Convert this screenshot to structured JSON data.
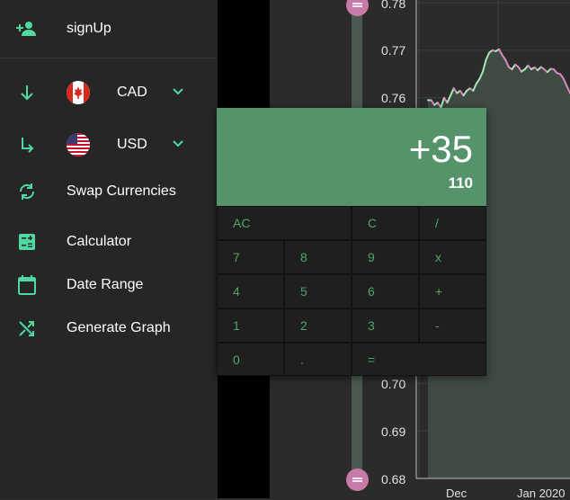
{
  "sidebar": {
    "signup_label": "signUp",
    "from_currency": "CAD",
    "to_currency": "USD",
    "swap_label": "Swap Currencies",
    "calculator_label": "Calculator",
    "date_range_label": "Date Range",
    "generate_label": "Generate Graph"
  },
  "colors": {
    "accent": "#4fd9a0",
    "display_green": "#55946a",
    "slider_thumb": "#c87aa8",
    "line_green": "#a8e6b8",
    "line_pink": "#d98ac0"
  },
  "calculator": {
    "display_main": "+35",
    "display_sub": "110",
    "keys": {
      "ac": "AC",
      "c": "C",
      "divide": "/",
      "k7": "7",
      "k8": "8",
      "k9": "9",
      "multiply": "x",
      "k4": "4",
      "k5": "5",
      "k6": "6",
      "plus": "+",
      "k1": "1",
      "k2": "2",
      "k3": "3",
      "minus": "-",
      "k0": "0",
      "dot": ".",
      "equals": "="
    }
  },
  "chart_data": {
    "type": "line",
    "y_ticks": [
      "0.78",
      "0.77",
      "0.76",
      "0.70",
      "0.69",
      "0.68"
    ],
    "x_ticks": [
      "Dec",
      "Jan 2020"
    ],
    "ylim": [
      0.68,
      0.78
    ],
    "grid": true,
    "series": [
      {
        "values": [
          0.7595,
          0.7595,
          0.7585,
          0.759,
          0.758,
          0.76,
          0.759,
          0.7605,
          0.762,
          0.761,
          0.7615,
          0.7605,
          0.7615,
          0.762,
          0.7615,
          0.763,
          0.764,
          0.7655,
          0.768,
          0.7695,
          0.77,
          0.7698,
          0.7702,
          0.769,
          0.768,
          0.7665,
          0.766,
          0.767,
          0.7665,
          0.7655,
          0.766,
          0.7668,
          0.766,
          0.7664,
          0.7658,
          0.7665,
          0.766,
          0.7654,
          0.7661,
          0.766,
          0.7652,
          0.765,
          0.764,
          0.7625,
          0.761
        ]
      }
    ]
  }
}
